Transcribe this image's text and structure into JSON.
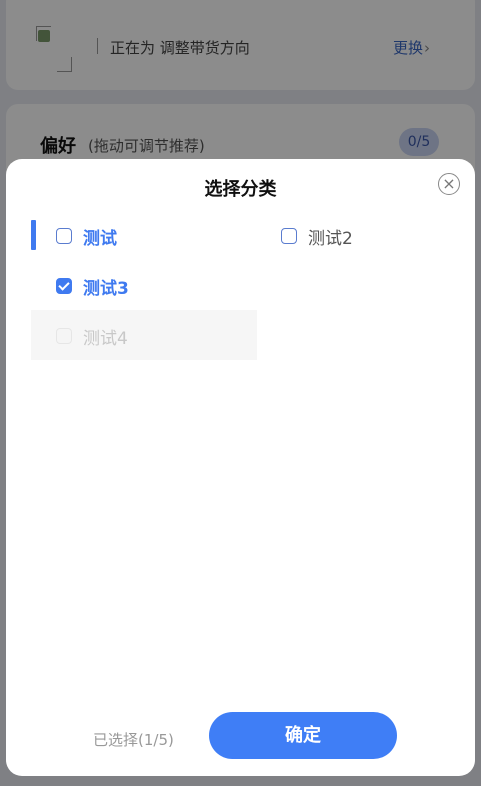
{
  "background": {
    "status_text": "正在为 调整带货方向",
    "switch_label": "更换",
    "preference_title": "偏好",
    "preference_subtitle": "(拖动可调节推荐)",
    "preference_count": "0/5"
  },
  "sheet": {
    "title": "选择分类",
    "close_icon": "close-circle-icon",
    "options": [
      {
        "label": "测试",
        "checked": false,
        "state": "selected"
      },
      {
        "label": "测试2",
        "checked": false,
        "state": "normal"
      },
      {
        "label": "测试3",
        "checked": true,
        "state": "selected"
      },
      {
        "label": "测试4",
        "checked": false,
        "state": "disabled"
      }
    ],
    "selected_count_text": "已选择(1/5)",
    "confirm_label": "确定"
  },
  "colors": {
    "accent": "#3f7af0",
    "overlay": "rgba(0,0,0,0.45)"
  }
}
